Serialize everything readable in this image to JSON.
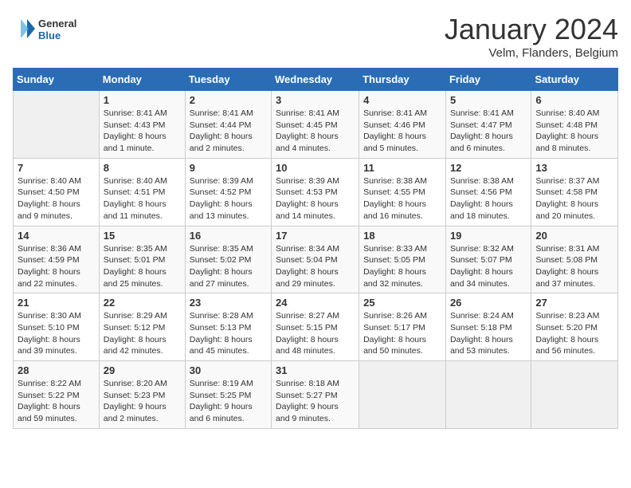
{
  "header": {
    "logo": {
      "general": "General",
      "blue": "Blue"
    },
    "title": "January 2024",
    "location": "Velm, Flanders, Belgium"
  },
  "days_of_week": [
    "Sunday",
    "Monday",
    "Tuesday",
    "Wednesday",
    "Thursday",
    "Friday",
    "Saturday"
  ],
  "weeks": [
    [
      {
        "day": "",
        "info": ""
      },
      {
        "day": "1",
        "info": "Sunrise: 8:41 AM\nSunset: 4:43 PM\nDaylight: 8 hours\nand 1 minute."
      },
      {
        "day": "2",
        "info": "Sunrise: 8:41 AM\nSunset: 4:44 PM\nDaylight: 8 hours\nand 2 minutes."
      },
      {
        "day": "3",
        "info": "Sunrise: 8:41 AM\nSunset: 4:45 PM\nDaylight: 8 hours\nand 4 minutes."
      },
      {
        "day": "4",
        "info": "Sunrise: 8:41 AM\nSunset: 4:46 PM\nDaylight: 8 hours\nand 5 minutes."
      },
      {
        "day": "5",
        "info": "Sunrise: 8:41 AM\nSunset: 4:47 PM\nDaylight: 8 hours\nand 6 minutes."
      },
      {
        "day": "6",
        "info": "Sunrise: 8:40 AM\nSunset: 4:48 PM\nDaylight: 8 hours\nand 8 minutes."
      }
    ],
    [
      {
        "day": "7",
        "info": "Sunrise: 8:40 AM\nSunset: 4:50 PM\nDaylight: 8 hours\nand 9 minutes."
      },
      {
        "day": "8",
        "info": "Sunrise: 8:40 AM\nSunset: 4:51 PM\nDaylight: 8 hours\nand 11 minutes."
      },
      {
        "day": "9",
        "info": "Sunrise: 8:39 AM\nSunset: 4:52 PM\nDaylight: 8 hours\nand 13 minutes."
      },
      {
        "day": "10",
        "info": "Sunrise: 8:39 AM\nSunset: 4:53 PM\nDaylight: 8 hours\nand 14 minutes."
      },
      {
        "day": "11",
        "info": "Sunrise: 8:38 AM\nSunset: 4:55 PM\nDaylight: 8 hours\nand 16 minutes."
      },
      {
        "day": "12",
        "info": "Sunrise: 8:38 AM\nSunset: 4:56 PM\nDaylight: 8 hours\nand 18 minutes."
      },
      {
        "day": "13",
        "info": "Sunrise: 8:37 AM\nSunset: 4:58 PM\nDaylight: 8 hours\nand 20 minutes."
      }
    ],
    [
      {
        "day": "14",
        "info": "Sunrise: 8:36 AM\nSunset: 4:59 PM\nDaylight: 8 hours\nand 22 minutes."
      },
      {
        "day": "15",
        "info": "Sunrise: 8:35 AM\nSunset: 5:01 PM\nDaylight: 8 hours\nand 25 minutes."
      },
      {
        "day": "16",
        "info": "Sunrise: 8:35 AM\nSunset: 5:02 PM\nDaylight: 8 hours\nand 27 minutes."
      },
      {
        "day": "17",
        "info": "Sunrise: 8:34 AM\nSunset: 5:04 PM\nDaylight: 8 hours\nand 29 minutes."
      },
      {
        "day": "18",
        "info": "Sunrise: 8:33 AM\nSunset: 5:05 PM\nDaylight: 8 hours\nand 32 minutes."
      },
      {
        "day": "19",
        "info": "Sunrise: 8:32 AM\nSunset: 5:07 PM\nDaylight: 8 hours\nand 34 minutes."
      },
      {
        "day": "20",
        "info": "Sunrise: 8:31 AM\nSunset: 5:08 PM\nDaylight: 8 hours\nand 37 minutes."
      }
    ],
    [
      {
        "day": "21",
        "info": "Sunrise: 8:30 AM\nSunset: 5:10 PM\nDaylight: 8 hours\nand 39 minutes."
      },
      {
        "day": "22",
        "info": "Sunrise: 8:29 AM\nSunset: 5:12 PM\nDaylight: 8 hours\nand 42 minutes."
      },
      {
        "day": "23",
        "info": "Sunrise: 8:28 AM\nSunset: 5:13 PM\nDaylight: 8 hours\nand 45 minutes."
      },
      {
        "day": "24",
        "info": "Sunrise: 8:27 AM\nSunset: 5:15 PM\nDaylight: 8 hours\nand 48 minutes."
      },
      {
        "day": "25",
        "info": "Sunrise: 8:26 AM\nSunset: 5:17 PM\nDaylight: 8 hours\nand 50 minutes."
      },
      {
        "day": "26",
        "info": "Sunrise: 8:24 AM\nSunset: 5:18 PM\nDaylight: 8 hours\nand 53 minutes."
      },
      {
        "day": "27",
        "info": "Sunrise: 8:23 AM\nSunset: 5:20 PM\nDaylight: 8 hours\nand 56 minutes."
      }
    ],
    [
      {
        "day": "28",
        "info": "Sunrise: 8:22 AM\nSunset: 5:22 PM\nDaylight: 8 hours\nand 59 minutes."
      },
      {
        "day": "29",
        "info": "Sunrise: 8:20 AM\nSunset: 5:23 PM\nDaylight: 9 hours\nand 2 minutes."
      },
      {
        "day": "30",
        "info": "Sunrise: 8:19 AM\nSunset: 5:25 PM\nDaylight: 9 hours\nand 6 minutes."
      },
      {
        "day": "31",
        "info": "Sunrise: 8:18 AM\nSunset: 5:27 PM\nDaylight: 9 hours\nand 9 minutes."
      },
      {
        "day": "",
        "info": ""
      },
      {
        "day": "",
        "info": ""
      },
      {
        "day": "",
        "info": ""
      }
    ]
  ]
}
